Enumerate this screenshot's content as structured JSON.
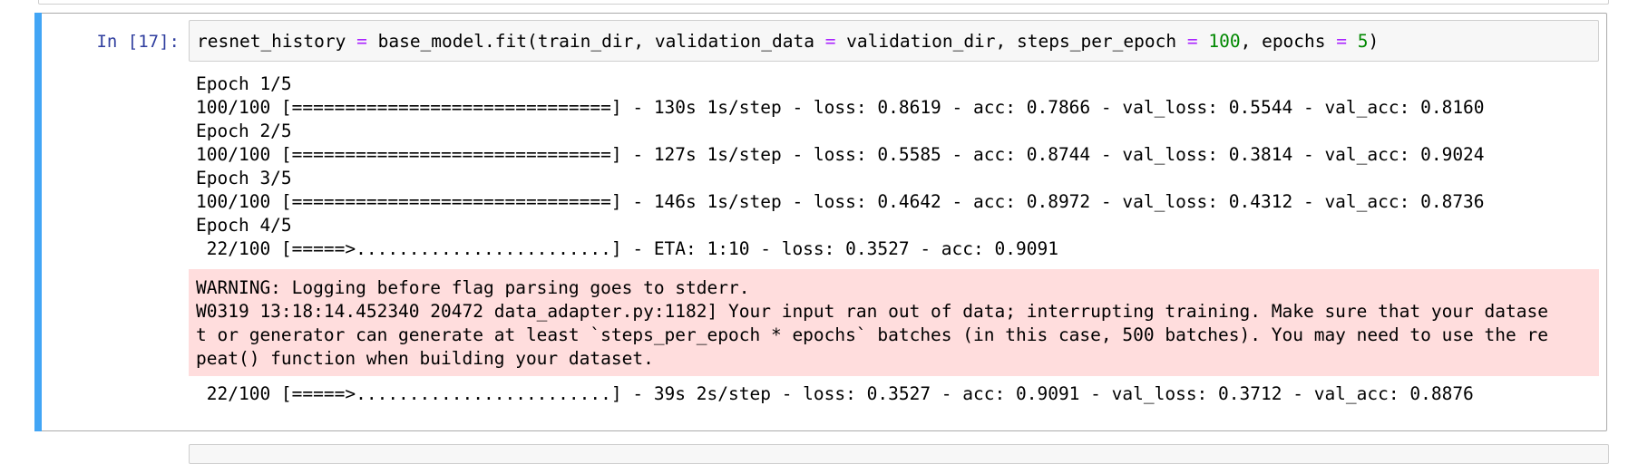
{
  "prompt": "In [17]:",
  "code": {
    "tokens": [
      {
        "text": "resnet_history ",
        "kind": "name"
      },
      {
        "text": "=",
        "kind": "op"
      },
      {
        "text": " base_model.fit(train_dir, validation_data ",
        "kind": "name"
      },
      {
        "text": "=",
        "kind": "op"
      },
      {
        "text": " validation_dir, steps_per_epoch ",
        "kind": "name"
      },
      {
        "text": "=",
        "kind": "op"
      },
      {
        "text": " ",
        "kind": "name"
      },
      {
        "text": "100",
        "kind": "num"
      },
      {
        "text": ", epochs ",
        "kind": "name"
      },
      {
        "text": "=",
        "kind": "op"
      },
      {
        "text": " ",
        "kind": "name"
      },
      {
        "text": "5",
        "kind": "num"
      },
      {
        "text": ")",
        "kind": "name"
      }
    ]
  },
  "stdout_lines": [
    "Epoch 1/5",
    "100/100 [==============================] - 130s 1s/step - loss: 0.8619 - acc: 0.7866 - val_loss: 0.5544 - val_acc: 0.8160",
    "Epoch 2/5",
    "100/100 [==============================] - 127s 1s/step - loss: 0.5585 - acc: 0.8744 - val_loss: 0.3814 - val_acc: 0.9024",
    "Epoch 3/5",
    "100/100 [==============================] - 146s 1s/step - loss: 0.4642 - acc: 0.8972 - val_loss: 0.4312 - val_acc: 0.8736",
    "Epoch 4/5",
    " 22/100 [=====>........................] - ETA: 1:10 - loss: 0.3527 - acc: 0.9091"
  ],
  "stderr_lines": [
    "WARNING: Logging before flag parsing goes to stderr.",
    "W0319 13:18:14.452340 20472 data_adapter.py:1182] Your input ran out of data; interrupting training. Make sure that your datase",
    "t or generator can generate at least `steps_per_epoch * epochs` batches (in this case, 500 batches). You may need to use the re",
    "peat() function when building your dataset."
  ],
  "final_line": " 22/100 [=====>........................] - 39s 2s/step - loss: 0.3527 - acc: 0.9091 - val_loss: 0.3712 - val_acc: 0.8876",
  "colors": {
    "prompt": "#303f9f",
    "operator": "#aa22ff",
    "number": "#008800",
    "cell_accent": "#42a5f5",
    "stderr_bg": "#ffdddd"
  }
}
